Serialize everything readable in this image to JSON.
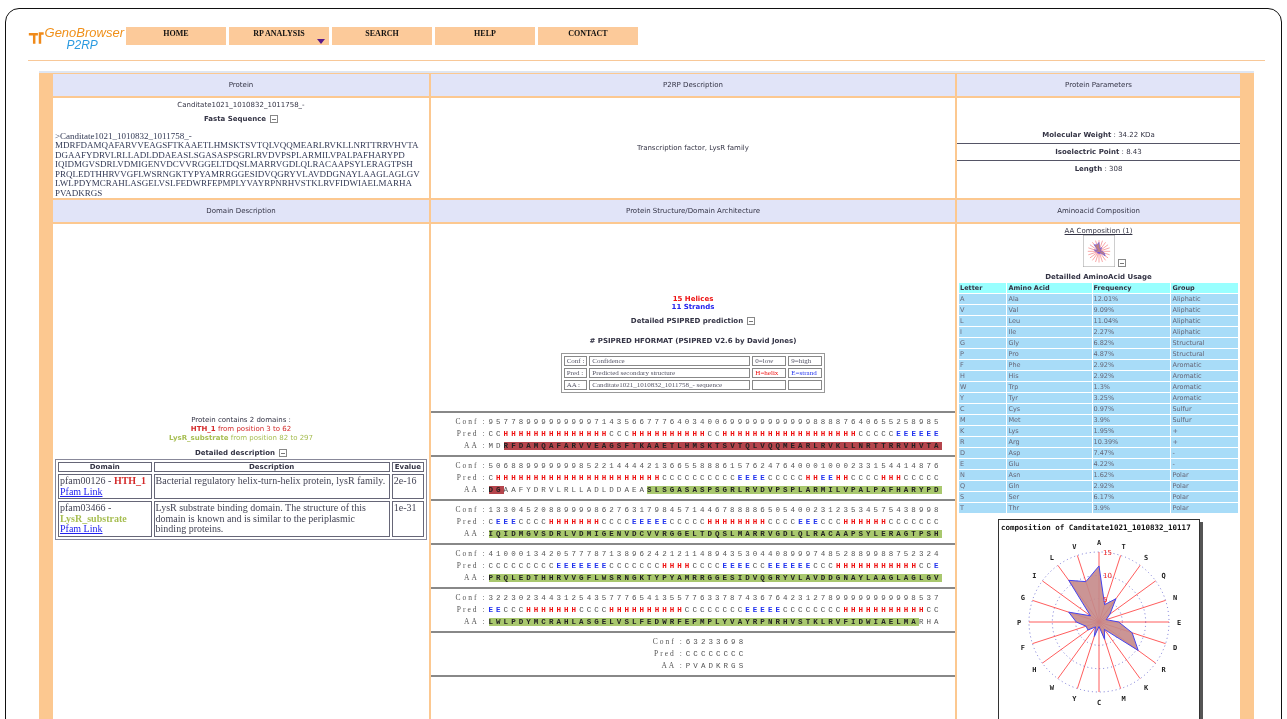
{
  "logo": {
    "name": "GenoBrowser",
    "sub": "P2RP"
  },
  "nav": [
    {
      "label": "HOME",
      "has_menu": false
    },
    {
      "label": "RP ANALYSIS",
      "has_menu": true
    },
    {
      "label": "SEARCH",
      "has_menu": false
    },
    {
      "label": "HELP",
      "has_menu": false
    },
    {
      "label": "CONTACT",
      "has_menu": false
    }
  ],
  "headers_top": [
    "Protein",
    "P2RP Description",
    "Protein Parameters"
  ],
  "protein": {
    "id": "Canditate1021_1010832_1011758_-",
    "fasta_title": "Fasta Sequence",
    "fasta_lines": [
      ">Canditate1021_1010832_1011758_-",
      "MDRFDAMQAFARVVEAGSFTKAAETLHMSKTSVTQLVQQMEARLRVKLLNRTTRRVHVTA",
      "DGAAFYDRVLRLLADLDDAEASLSGASASPSGRLRVDVPSPLARMILVPALPAFHARYPD",
      "IQIDMGVSDRLVDMIGENVDCVVRGGELTDQSLMARRVGDLQLRACAAPSYLERAGTPSH",
      "PRQLEDTHHRVVGFLWSRNGKTYPYAMRRGGESIDVQGRYVLAVDDGNAYLAAGLAGLGV",
      "LWLPDYMCRAHLASGELVSLFEDWRFEPMPLYVAYRPNRHVSTKLRVFIDWIAELMARHA",
      "PVADKRGS"
    ]
  },
  "description": "Transcription factor, LysR family",
  "parameters": [
    {
      "label": "Molecular Weight",
      "value": " : 34.22 KDa"
    },
    {
      "label": "Isoelectric Point",
      "value": " : 8.43"
    },
    {
      "label": "Length",
      "value": " : 308"
    }
  ],
  "headers_bottom": [
    "Domain Description",
    "Protein Structure/Domain Architecture",
    "Aminoacid Composition"
  ],
  "domains": {
    "summary": "Protein contains 2 domains :",
    "items": [
      {
        "name": "HTH_1",
        "text": " from position 3 to 62",
        "kind": "hth"
      },
      {
        "name": "LysR_substrate",
        "text": " from position 82 to 297",
        "kind": "lysr"
      }
    ],
    "detail_title": "Detailed description",
    "columns": [
      "Domain",
      "Description",
      "Evalue"
    ],
    "rows": [
      {
        "id": "pfam00126 - ",
        "name": "HTH_1",
        "kind": "hth",
        "link": "Pfam Link",
        "description": "Bacterial regulatory helix-turn-helix protein, lysR family.",
        "evalue": "2e-16"
      },
      {
        "id": "pfam03466 - ",
        "name": "LysR_substrate",
        "kind": "lysr",
        "link": "Pfam Link",
        "description": "LysR substrate binding domain. The structure of this domain is known and is similar to the periplasmic binding proteins.",
        "evalue": "1e-31"
      }
    ]
  },
  "psipred": {
    "helices": "15 Helices",
    "strands": "11 Strands",
    "detail_title": "Detailed PSIPRED prediction",
    "format_title": "# PSIPRED HFORMAT (PSIPRED V2.6 by David Jones)",
    "legend": [
      [
        {
          "text": "Conf :",
          "kind": "plain"
        },
        {
          "text": "Confidence",
          "kind": "plain"
        },
        {
          "text": "0=low",
          "kind": "plain"
        },
        {
          "text": "9=high",
          "kind": "plain"
        }
      ],
      [
        {
          "text": "Pred :",
          "kind": "plain"
        },
        {
          "text": "Predicted secondary structure",
          "kind": "plain"
        },
        {
          "text": "H=helix",
          "kind": "helix"
        },
        {
          "text": "E=strand",
          "kind": "strand"
        }
      ],
      [
        {
          "text": "AA :",
          "kind": "plain"
        },
        {
          "text": "Canditate1021_1010832_1011758_- sequence",
          "kind": "plain"
        },
        {
          "kind": "plain"
        },
        {
          "kind": "plain"
        }
      ]
    ],
    "blocks": [
      {
        "labels": [
          "Conf :",
          "Pred :",
          "AA :"
        ],
        "conf": "957789999999997143566777640340069999999999988887640655258985",
        "pred": [
          {
            "text": "CC",
            "kind": "coil"
          },
          {
            "text": "HHHHHHHHHHHHHH",
            "kind": "helix"
          },
          {
            "text": "CCC",
            "kind": "coil"
          },
          {
            "text": "HHHHHHHHHH",
            "kind": "helix"
          },
          {
            "text": "CC",
            "kind": "coil"
          },
          {
            "text": "HHHHHHHHHHHHHHHHHH",
            "kind": "helix"
          },
          {
            "text": "CCCCC",
            "kind": "coil"
          },
          {
            "text": "EEEEEE",
            "kind": "strand"
          }
        ],
        "aa": [
          {
            "text": "MD",
            "kind": "none"
          },
          {
            "text": "RFDAMQAFARVVEAGSFTKAAETLHMSKTSVTQLVQQMEARLRVKLLNRTTRRVHVTA",
            "kind": "hth"
          }
        ]
      },
      {
        "labels": [
          "Conf :",
          "Pred :",
          "AA :"
        ],
        "conf": "506889999999852214444213665588861576247640001000233154414876",
        "pred": [
          {
            "text": "C",
            "kind": "coil"
          },
          {
            "text": "HHHHHHHHHHHHHHHHHHHHHH",
            "kind": "helix"
          },
          {
            "text": "CCCCCCCCCC",
            "kind": "coil"
          },
          {
            "text": "EEEE",
            "kind": "strand"
          },
          {
            "text": "CCCCC",
            "kind": "coil"
          },
          {
            "text": "HH",
            "kind": "helix"
          },
          {
            "text": "EE",
            "kind": "strand"
          },
          {
            "text": "HH",
            "kind": "helix"
          },
          {
            "text": "CCCC",
            "kind": "coil"
          },
          {
            "text": "HHH",
            "kind": "helix"
          },
          {
            "text": "CCCCC",
            "kind": "coil"
          }
        ],
        "aa": [
          {
            "text": "DG",
            "kind": "hth"
          },
          {
            "text": "AAFYDRVLRLLADLDDAEA",
            "kind": "none"
          },
          {
            "text": "SLSGASASPSGRLRVDVPSPLARMILVPALPAFHARYPD",
            "kind": "lysr"
          }
        ]
      },
      {
        "labels": [
          "Conf :",
          "Pred :",
          "AA :"
        ],
        "conf": "133045208899998627631798457144678888650540023123534575438998",
        "pred": [
          {
            "text": "C",
            "kind": "coil"
          },
          {
            "text": "EEE",
            "kind": "strand"
          },
          {
            "text": "CCCC",
            "kind": "coil"
          },
          {
            "text": "HHHHHHH",
            "kind": "helix"
          },
          {
            "text": "CCCC",
            "kind": "coil"
          },
          {
            "text": "EEEEE",
            "kind": "strand"
          },
          {
            "text": "CCCCC",
            "kind": "coil"
          },
          {
            "text": "HHHHHHHH",
            "kind": "helix"
          },
          {
            "text": "CCCC",
            "kind": "coil"
          },
          {
            "text": "EEE",
            "kind": "strand"
          },
          {
            "text": "CCC",
            "kind": "coil"
          },
          {
            "text": "HHHHHH",
            "kind": "helix"
          },
          {
            "text": "CCCCCCC",
            "kind": "coil"
          }
        ],
        "aa": [
          {
            "text": "IQIDMGVSDRLVDMIGENVDCVVRGGELTDQSLMARRVGDLQLRACAAPSYLERAGTPSH",
            "kind": "lysr"
          }
        ]
      },
      {
        "labels": [
          "Conf :",
          "Pred :",
          "AA :"
        ],
        "conf": "410001342057778713896242121148943530440899974852889988752324",
        "pred": [
          {
            "text": "CCCCCCCCC",
            "kind": "coil"
          },
          {
            "text": "EEEEEEE",
            "kind": "strand"
          },
          {
            "text": "CCCCCCC",
            "kind": "coil"
          },
          {
            "text": "HHHH",
            "kind": "helix"
          },
          {
            "text": "CCCC",
            "kind": "coil"
          },
          {
            "text": "EEEE",
            "kind": "strand"
          },
          {
            "text": "CC",
            "kind": "coil"
          },
          {
            "text": "EEEEEE",
            "kind": "strand"
          },
          {
            "text": "CCC",
            "kind": "coil"
          },
          {
            "text": "HHHHHHHHHHH",
            "kind": "helix"
          },
          {
            "text": "CC",
            "kind": "coil"
          },
          {
            "text": "E",
            "kind": "strand"
          }
        ],
        "aa": [
          {
            "text": "PRQLEDTHHRVVGFLWSRNGKTYPYAMRRGGESIDVQGRYVLAVDDGNAYLAAGLAGLGV",
            "kind": "lysr"
          }
        ]
      },
      {
        "labels": [
          "Conf :",
          "Pred :",
          "AA :"
        ],
        "conf": "322302344312543577765413557763378743676423127899999999998537",
        "pred": [
          {
            "text": "EE",
            "kind": "strand"
          },
          {
            "text": "CCC",
            "kind": "coil"
          },
          {
            "text": "HHHHHHH",
            "kind": "helix"
          },
          {
            "text": "CCCC",
            "kind": "coil"
          },
          {
            "text": "HHHHHHHHHH",
            "kind": "helix"
          },
          {
            "text": "CCCCCCCC",
            "kind": "coil"
          },
          {
            "text": "EEEEE",
            "kind": "strand"
          },
          {
            "text": "CCCCCCCC",
            "kind": "coil"
          },
          {
            "text": "HHHHHHHHHHH",
            "kind": "helix"
          },
          {
            "text": "CC",
            "kind": "coil"
          }
        ],
        "aa": [
          {
            "text": "LWLPDYMCRAHLASGELVSLFEDWRFEPMPLYVAYRPNRHVSTKLRVFIDWIAELMA",
            "kind": "lysr"
          },
          {
            "text": "RHA",
            "kind": "none"
          }
        ]
      },
      {
        "labels": [
          "Conf :",
          "Pred :",
          "AA :"
        ],
        "conf": "63233698",
        "pred": [
          {
            "text": "CCCCCCCC",
            "kind": "coil"
          }
        ],
        "aa": [
          {
            "text": "PVADKRGS",
            "kind": "none"
          }
        ]
      }
    ]
  },
  "composition": {
    "link": "AA Composition (1)",
    "usage_title": "Detailled AminoAcid Usage",
    "columns": [
      "Letter",
      "Amino Acid",
      "Frequency",
      "Group"
    ],
    "rows": [
      [
        "A",
        "Ala",
        "12.01%",
        "Aliphatic"
      ],
      [
        "V",
        "Val",
        "9.09%",
        "Aliphatic"
      ],
      [
        "L",
        "Leu",
        "11.04%",
        "Aliphatic"
      ],
      [
        "I",
        "Ile",
        "2.27%",
        "Aliphatic"
      ],
      [
        "G",
        "Gly",
        "6.82%",
        "Structural"
      ],
      [
        "P",
        "Pro",
        "4.87%",
        "Structural"
      ],
      [
        "F",
        "Phe",
        "2.92%",
        "Aromatic"
      ],
      [
        "H",
        "His",
        "2.92%",
        "Aromatic"
      ],
      [
        "W",
        "Trp",
        "1.3%",
        "Aromatic"
      ],
      [
        "Y",
        "Tyr",
        "3.25%",
        "Aromatic"
      ],
      [
        "C",
        "Cys",
        "0.97%",
        "Sulfur"
      ],
      [
        "M",
        "Met",
        "3.9%",
        "Sulfur"
      ],
      [
        "K",
        "Lys",
        "1.95%",
        "+"
      ],
      [
        "R",
        "Arg",
        "10.39%",
        "+"
      ],
      [
        "D",
        "Asp",
        "7.47%",
        "-"
      ],
      [
        "E",
        "Glu",
        "4.22%",
        "-"
      ],
      [
        "N",
        "Asn",
        "1.62%",
        "Polar"
      ],
      [
        "Q",
        "Gln",
        "2.92%",
        "Polar"
      ],
      [
        "S",
        "Ser",
        "6.17%",
        "Polar"
      ],
      [
        "T",
        "Thr",
        "3.9%",
        "Polar"
      ]
    ],
    "radar": {
      "title": "composition of Canditate1021_1010832_10117",
      "axis_labels": [
        "V",
        "A",
        "T",
        "L",
        "S",
        "I",
        "Q",
        "G",
        "N",
        "P",
        "E",
        "F",
        "D",
        "H",
        "R",
        "W",
        "K",
        "Y",
        "M",
        "C"
      ],
      "ring_labels": [
        "15",
        "10",
        "5"
      ]
    }
  }
}
